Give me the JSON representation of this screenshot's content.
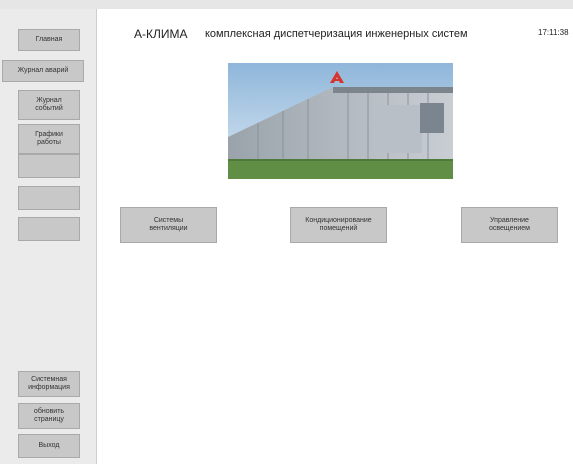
{
  "header": {
    "brand": "А-КЛИМА",
    "subtitle": "комплексная диспетчеризация инженерных систем",
    "time": "17:11:38"
  },
  "sidebar": {
    "items": [
      {
        "label": "Главная"
      },
      {
        "label": "Журнал аварий"
      },
      {
        "label": "Журнал\nсобытий"
      },
      {
        "label": "Графики\nработы"
      },
      {
        "label": ""
      },
      {
        "label": ""
      },
      {
        "label": ""
      }
    ],
    "bottom_items": [
      {
        "label": "Системная\nинформация"
      },
      {
        "label": "обновить\nстраницу"
      },
      {
        "label": "Выход"
      }
    ]
  },
  "main": {
    "buttons": [
      {
        "label": "Системы\nвентиляции"
      },
      {
        "label": "Кондиционирование\nпомещений"
      },
      {
        "label": "Управление\nосвещением"
      }
    ]
  },
  "colors": {
    "button_bg": "#c8c8c8",
    "sidebar_bg": "#ebebeb",
    "main_bg": "#ffffff",
    "logo_red": "#d9342b"
  },
  "icons": {
    "logo": "a-klima-logo-icon"
  }
}
